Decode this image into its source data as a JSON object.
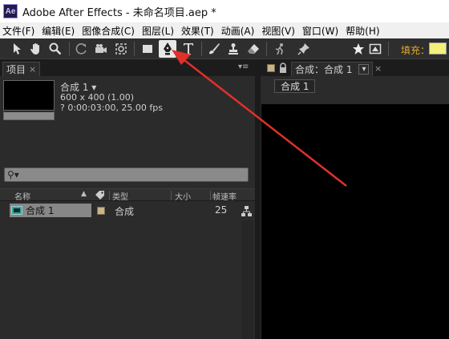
{
  "window": {
    "logo_text": "Ae",
    "title": "Adobe After Effects - 未命名项目.aep *"
  },
  "menu": {
    "items": [
      "文件(F)",
      "编辑(E)",
      "图像合成(C)",
      "图层(L)",
      "效果(T)",
      "动画(A)",
      "视图(V)",
      "窗口(W)",
      "帮助(H)"
    ]
  },
  "toolbar": {
    "tools": [
      "select-tool-icon",
      "hand-tool-icon",
      "zoom-tool-icon",
      "rotate-tool-icon",
      "camera-tool-icon",
      "pan-behind-tool-icon",
      "rectangle-tool-icon",
      "pen-tool-icon",
      "text-tool-icon",
      "brush-tool-icon",
      "clone-stamp-tool-icon",
      "eraser-tool-icon",
      "roto-brush-tool-icon",
      "puppet-pin-tool-icon",
      "star-icon",
      "tool-options-icon"
    ],
    "active_tool": "pen-tool-icon",
    "fill_label": "填充：",
    "fill_color": "#f4f07a"
  },
  "project_panel": {
    "tab_label": "项目",
    "tab_close": "×",
    "menu_glyph": "▾≡",
    "comp_name": "合成 1 ▾",
    "comp_size": "600 x 400 (1.00)",
    "comp_duration": "? 0:00:03:00, 25.00 fps",
    "search_icon": "⚲▾",
    "columns": [
      "名称",
      "类型",
      "大小",
      "帧速率"
    ],
    "sort_glyph": "▲",
    "rows": [
      {
        "name": "合成 1",
        "type": "合成",
        "size": "",
        "fps": "25",
        "label_color": "#c8b48a"
      }
    ]
  },
  "comp_panel": {
    "tab_label": "合成：合成 1",
    "tab_dropdown": "▾",
    "tab_close": "×",
    "lock_icon": "lock-icon",
    "sub_tab": "合成 1"
  },
  "colors": {
    "accent_fill_label": "#e1a92d",
    "annotation_arrow": "#e0302a"
  }
}
